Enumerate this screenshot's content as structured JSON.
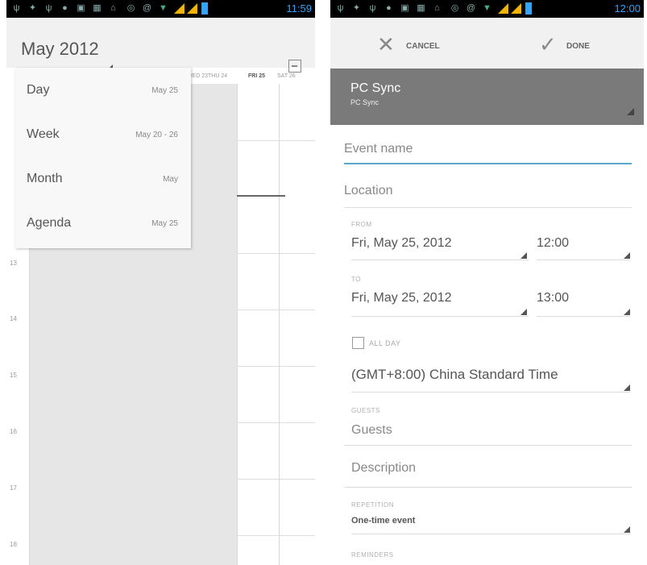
{
  "left_screen": {
    "status_time": "11:59",
    "calendar": {
      "title": "May 2012",
      "day_strip": [
        "WED 23",
        "THU 24",
        "FRI 25",
        "SAT 26"
      ],
      "hours": [
        "13",
        "14",
        "15",
        "16",
        "17",
        "18"
      ]
    },
    "view_menu": [
      {
        "label": "Day",
        "date": "May 25"
      },
      {
        "label": "Week",
        "date": "May 20 - 26"
      },
      {
        "label": "Month",
        "date": "May"
      },
      {
        "label": "Agenda",
        "date": "May 25"
      }
    ]
  },
  "right_screen": {
    "status_time": "12:00",
    "action_bar": {
      "cancel": "CANCEL",
      "done": "DONE"
    },
    "account": {
      "name": "PC Sync",
      "sub": "PC Sync"
    },
    "form": {
      "event_name_placeholder": "Event name",
      "location_placeholder": "Location",
      "from_label": "FROM",
      "from_date": "Fri, May 25, 2012",
      "from_time": "12:00",
      "to_label": "TO",
      "to_date": "Fri, May 25, 2012",
      "to_time": "13:00",
      "all_day_label": "ALL DAY",
      "timezone": "(GMT+8:00) China Standard Time",
      "guests_label": "GUESTS",
      "guests_placeholder": "Guests",
      "description_placeholder": "Description",
      "repetition_label": "REPETITION",
      "repetition_value": "One-time event",
      "reminders_label": "REMINDERS"
    }
  },
  "colors": {
    "accent": "#35a3ff",
    "account_bg": "#7a7a7a",
    "focus_line": "#5aa7cc"
  }
}
